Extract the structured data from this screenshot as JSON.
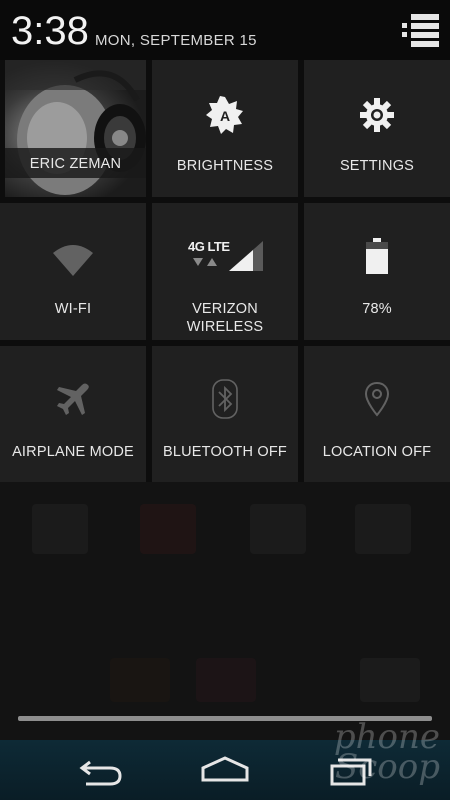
{
  "status": {
    "time": "3:38",
    "date": "MON, SEPTEMBER 15"
  },
  "tiles": {
    "user": {
      "label": "ERIC ZEMAN",
      "icon": "user-photo"
    },
    "brightness": {
      "label": "BRIGHTNESS",
      "icon": "brightness-auto-icon"
    },
    "settings": {
      "label": "SETTINGS",
      "icon": "gear-icon"
    },
    "wifi": {
      "label": "WI-FI",
      "icon": "wifi-icon"
    },
    "network": {
      "label_line1": "VERIZON",
      "label_line2": "WIRELESS",
      "network_type": "4G LTE",
      "icon": "signal-icon"
    },
    "battery": {
      "label": "78%",
      "level": 0.78,
      "icon": "battery-icon"
    },
    "airplane": {
      "label": "AIRPLANE MODE",
      "icon": "airplane-icon"
    },
    "bluetooth": {
      "label": "BLUETOOTH OFF",
      "icon": "bluetooth-icon"
    },
    "location": {
      "label": "LOCATION OFF",
      "icon": "location-pin-icon"
    }
  },
  "navigation": {
    "buttons": [
      "back",
      "home",
      "recents"
    ]
  },
  "watermark": {
    "line1": "phone",
    "line2": "Scoop"
  },
  "colors": {
    "tile_bg": "#202020",
    "header_bg": "#0a0a0a",
    "navbar_bg": "#0e2a36"
  }
}
